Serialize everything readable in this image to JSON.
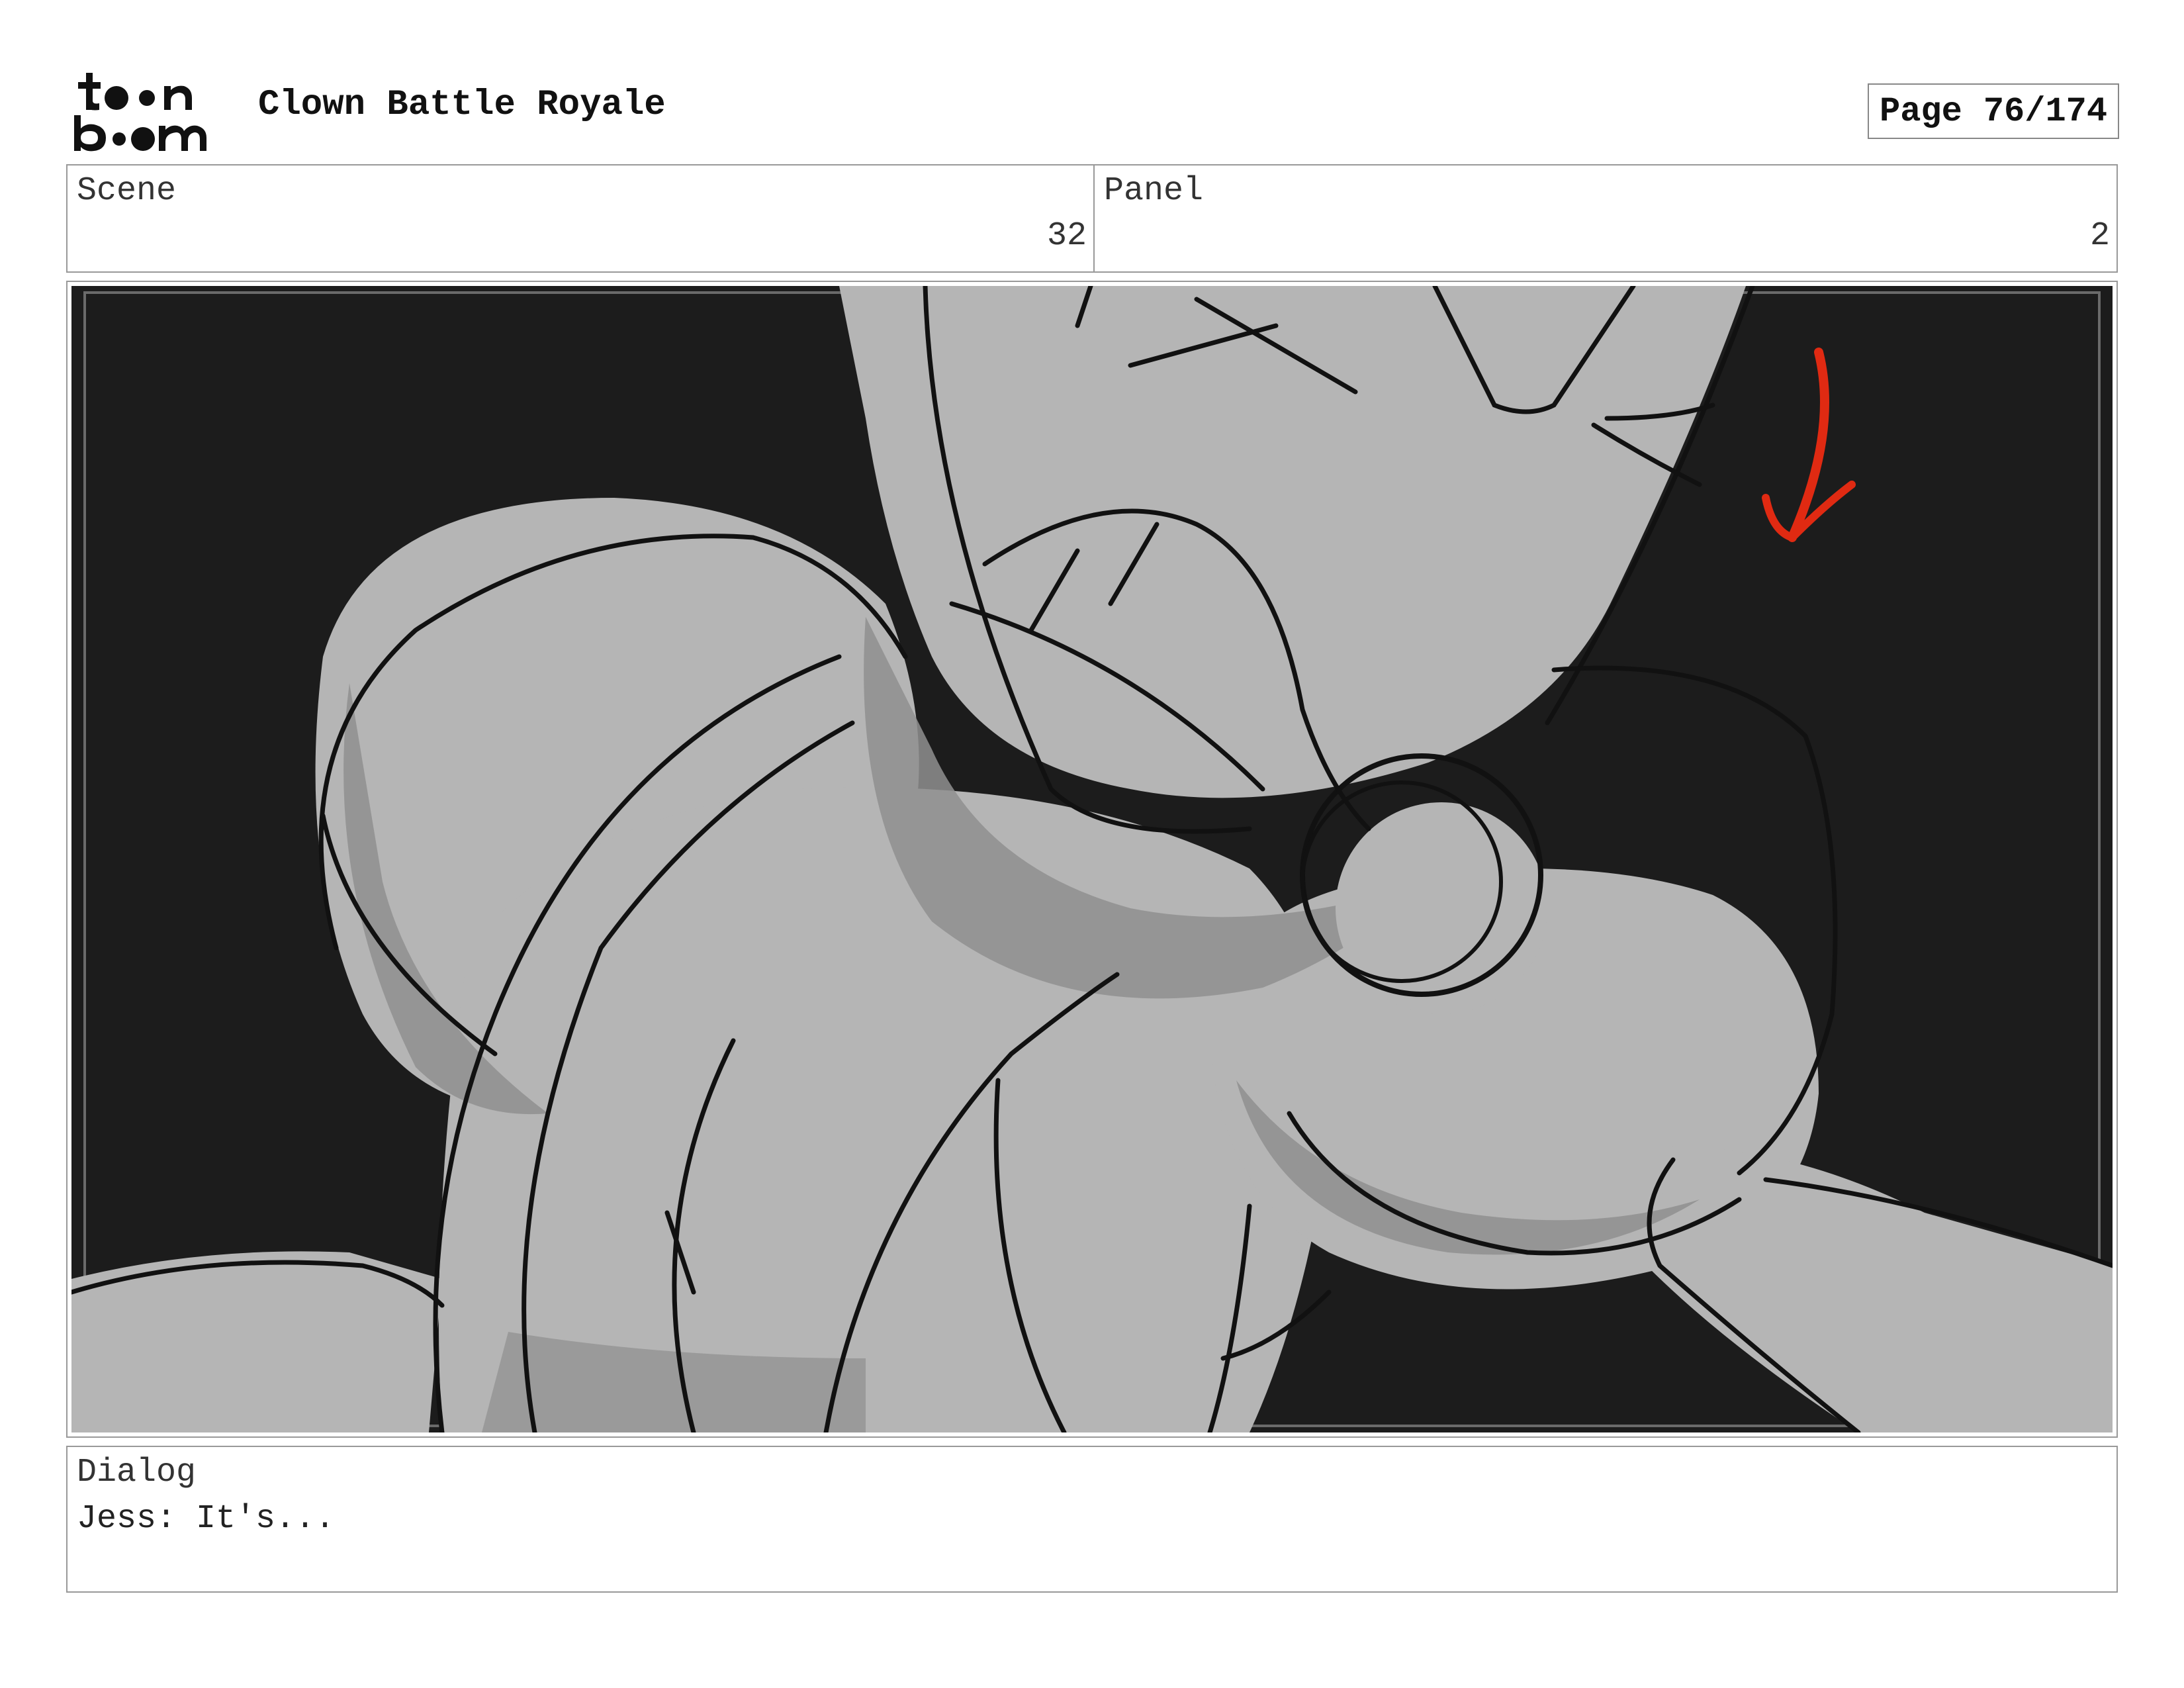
{
  "header": {
    "logo_text": "toon boom",
    "project_title": "Clown Battle Royale",
    "page_label": "Page",
    "page_value": "76/174"
  },
  "info": {
    "scene_label": "Scene",
    "scene_value": "32",
    "panel_label": "Panel",
    "panel_value": "2"
  },
  "dialog": {
    "label": "Dialog",
    "text": "Jess: It's..."
  },
  "artwork": {
    "description_icon": "storyboard-sketch",
    "background_color": "#1c1c1c",
    "fill_color": "#b5b5b5",
    "shadow_color": "#8f8f8f",
    "line_color": "#111111",
    "arrow_color": "#e02a12"
  }
}
